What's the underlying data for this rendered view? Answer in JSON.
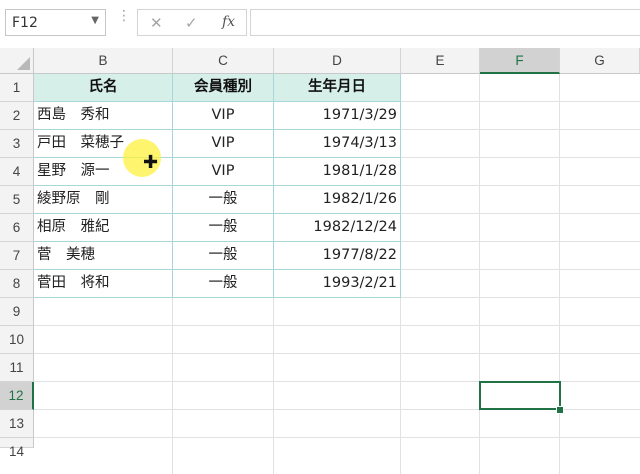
{
  "formula_bar": {
    "name_box": "F12",
    "cancel_icon": "✕",
    "enter_icon": "✓",
    "fx_label": "fx",
    "formula": ""
  },
  "columns": [
    "B",
    "C",
    "D",
    "E",
    "F",
    "G"
  ],
  "selected_column": "F",
  "rows": [
    "1",
    "2",
    "3",
    "4",
    "5",
    "6",
    "7",
    "8",
    "9",
    "10",
    "11",
    "12",
    "13",
    "14"
  ],
  "selected_row": "12",
  "selected_cell": "F12",
  "table": {
    "headers": [
      "氏名",
      "会員種別",
      "生年月日"
    ],
    "rows": [
      [
        "西島　秀和",
        "VIP",
        "1971/3/29"
      ],
      [
        "戸田　菜穂子",
        "VIP",
        "1974/3/13"
      ],
      [
        "星野　源一",
        "VIP",
        "1981/1/28"
      ],
      [
        "綾野原　剛",
        "一般",
        "1982/1/26"
      ],
      [
        "相原　雅紀",
        "一般",
        "1982/12/24"
      ],
      [
        "菅　美穂",
        "一般",
        "1977/8/22"
      ],
      [
        "菅田　将和",
        "一般",
        "1993/2/21"
      ]
    ]
  },
  "colors": {
    "accent": "#217346",
    "table_header_fill": "#d7efe9",
    "table_border": "#a9d7d7",
    "cursor_highlight": "#fff03c"
  }
}
